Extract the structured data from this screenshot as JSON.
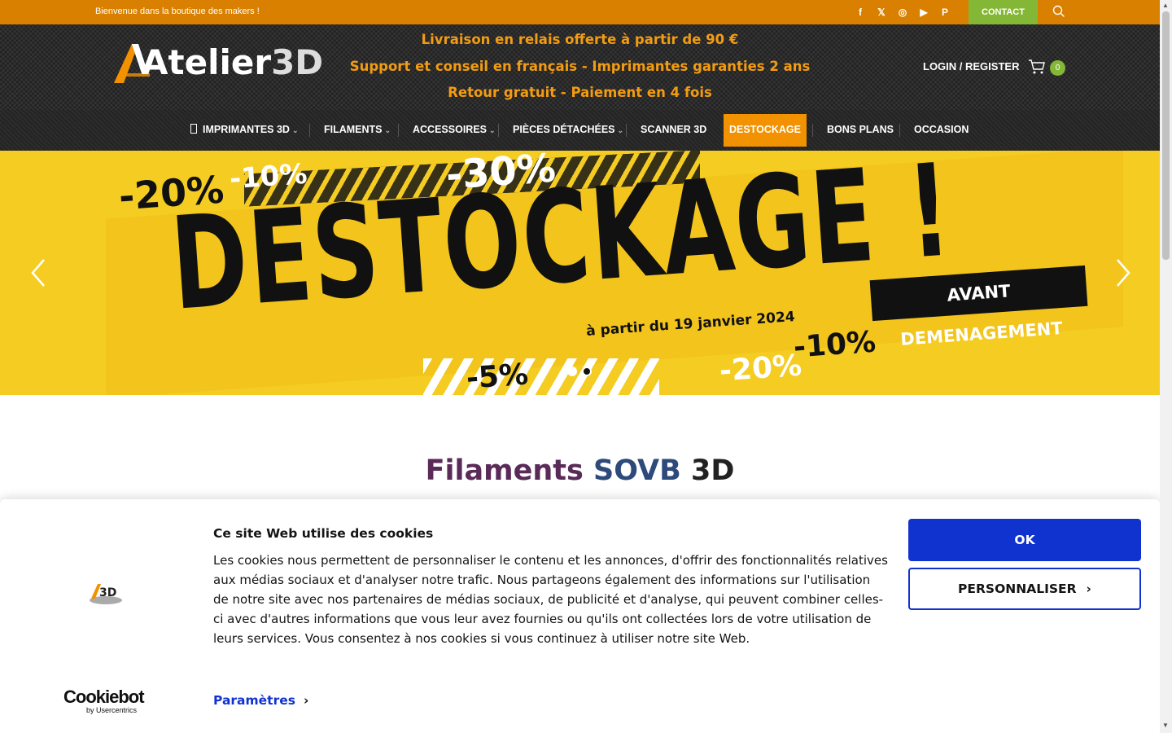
{
  "topbar": {
    "welcome": "Bienvenue dans la boutique des makers !",
    "social": [
      {
        "icon": "facebook-icon",
        "glyph": "f"
      },
      {
        "icon": "x-icon",
        "glyph": "𝕏"
      },
      {
        "icon": "instagram-icon",
        "glyph": "◎"
      },
      {
        "icon": "youtube-icon",
        "glyph": "▶"
      },
      {
        "icon": "pinterest-icon",
        "glyph": "P"
      }
    ],
    "contact_label": "CONTACT",
    "colors": {
      "bar": "#d98000",
      "contact": "#83b735"
    }
  },
  "header": {
    "logo_main": "Atelier",
    "logo_accent": "3D",
    "promo": [
      "Livraison en relais offerte à partir de 90 €",
      "Support et conseil en français - Imprimantes garanties 2 ans",
      "Retour gratuit - Paiement en 4 fois"
    ],
    "login_label": "LOGIN / REGISTER",
    "cart_count": "0",
    "colors": {
      "promo": "#f39c12"
    }
  },
  "nav": {
    "items": [
      {
        "label": "IMPRIMANTES 3D",
        "dropdown": true
      },
      {
        "label": "FILAMENTS",
        "dropdown": true
      },
      {
        "label": "ACCESSOIRES",
        "dropdown": true
      },
      {
        "label": "PIÈCES DÉTACHÉES",
        "dropdown": true
      },
      {
        "label": "SCANNER 3D",
        "dropdown": false
      },
      {
        "label": "DESTOCKAGE",
        "dropdown": false,
        "active": true
      },
      {
        "label": "BONS PLANS",
        "dropdown": false
      },
      {
        "label": "OCCASION",
        "dropdown": false
      }
    ],
    "colors": {
      "active_bg": "#f39200"
    }
  },
  "banner": {
    "headline": "DESTOCKAGE !",
    "tag": "AVANT DEMENAGEMENT",
    "date_line": "à partir du 19 janvier 2024",
    "percents": [
      "-20%",
      "-10%",
      "-30%",
      "-5%",
      "-20%",
      "-10%"
    ],
    "slides_total": 2,
    "active_slide": 2,
    "colors": {
      "bg": "#f5cc22"
    }
  },
  "section": {
    "title_w1": "Filaments",
    "title_w2": "SOVB",
    "title_w3": "3D"
  },
  "cookie": {
    "title": "Ce site Web utilise des cookies",
    "text": "Les cookies nous permettent de personnaliser le contenu et les annonces, d'offrir des fonctionnalités relatives aux médias sociaux et d'analyser notre trafic. Nous partageons également des informations sur l'utilisation de notre site avec nos partenaires de médias sociaux, de publicité et d'analyse, qui peuvent combiner celles-ci avec d'autres informations que vous leur avez fournies ou qu'ils ont collectées lors de votre utilisation de leurs services. Vous consentez à nos cookies si vous continuez à utiliser notre site Web.",
    "params_label": "Paramètres",
    "ok_label": "OK",
    "customize_label": "PERSONNALISER",
    "brand_name": "Cookiebot",
    "brand_by": "by Usercentrics",
    "logo_text": "A3D",
    "colors": {
      "primary": "#1032cf"
    }
  }
}
